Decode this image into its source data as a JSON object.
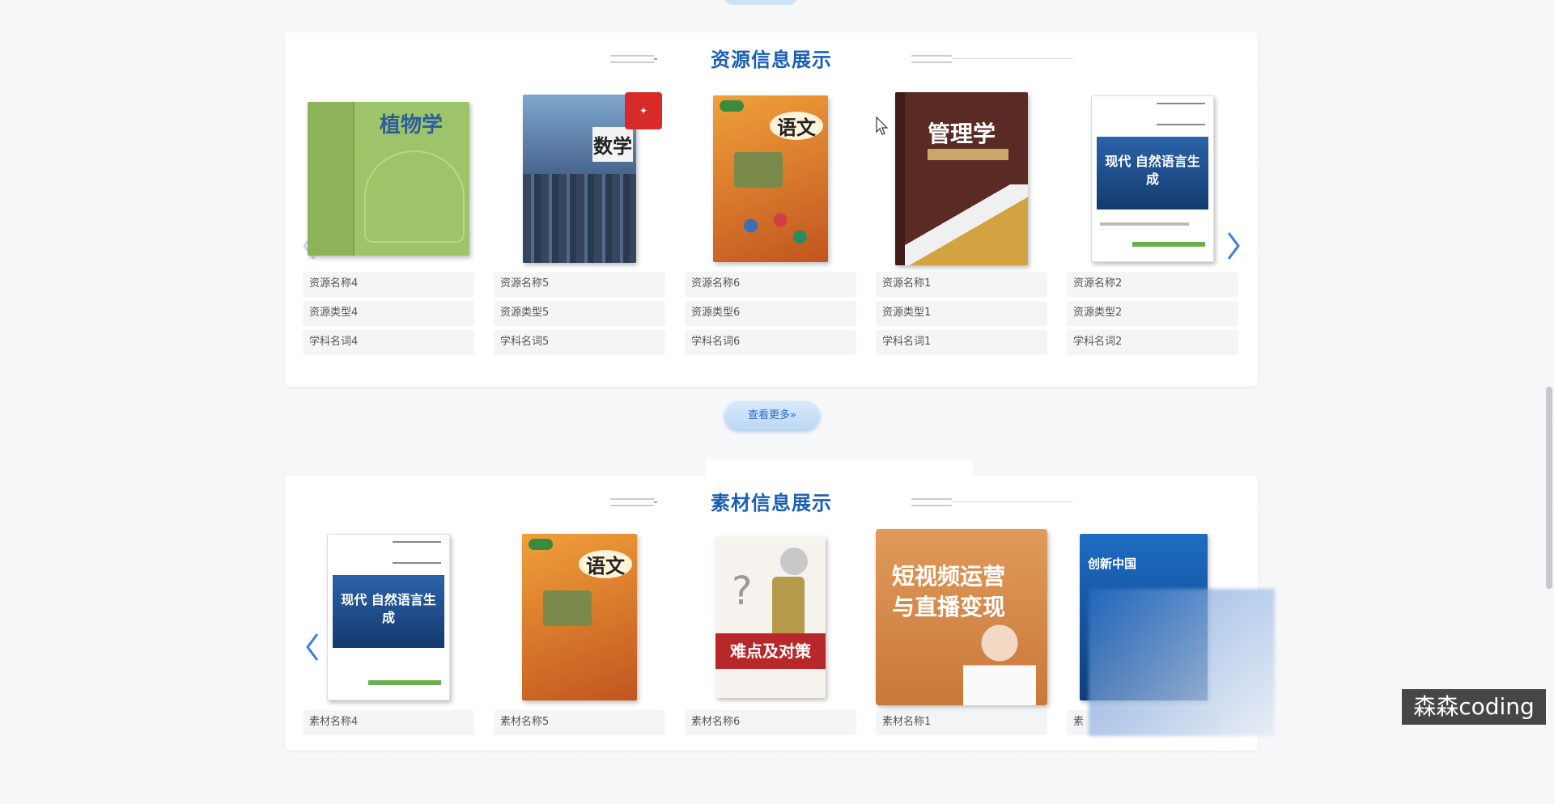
{
  "resource_section": {
    "title": "资源信息展示",
    "cards": [
      {
        "name": "资源名称4",
        "type": "资源类型4",
        "subject": "学科名词4",
        "cover_text": "植物学",
        "cover_color": "#9ec46a"
      },
      {
        "name": "资源名称5",
        "type": "资源类型5",
        "subject": "学科名词5",
        "cover_text": "数学",
        "cover_color": "#5a7fa8"
      },
      {
        "name": "资源名称6",
        "type": "资源类型6",
        "subject": "学科名词6",
        "cover_text": "语文",
        "cover_color": "#e2902e"
      },
      {
        "name": "资源名称1",
        "type": "资源类型1",
        "subject": "学科名词1",
        "cover_text": "管理学",
        "cover_color": "#5a2a24"
      },
      {
        "name": "资源名称2",
        "type": "资源类型2",
        "subject": "学科名词2",
        "cover_text": "现代 自然语言生成",
        "cover_color": "#1e4f8f"
      }
    ]
  },
  "more_button": {
    "label": "查看更多»"
  },
  "material_section": {
    "title": "素材信息展示",
    "cards": [
      {
        "name": "素材名称4",
        "cover_text": "现代 自然语言生成",
        "cover_color": "#1e4f8f"
      },
      {
        "name": "素材名称5",
        "cover_text": "语文",
        "cover_color": "#e2902e"
      },
      {
        "name": "素材名称6",
        "cover_text": "难点及对策",
        "cover_color": "#b8282a"
      },
      {
        "name": "素材名称1",
        "cover_text": "短视频运营 与直播变现",
        "cover_color": "#d9894a"
      },
      {
        "name": "素",
        "cover_text": "创新中国",
        "cover_color": "#1e6cc4"
      }
    ]
  },
  "watermark": {
    "text": "森森coding"
  },
  "colors": {
    "accent": "#1b5fb5",
    "arrow": "#3a7fe0"
  }
}
